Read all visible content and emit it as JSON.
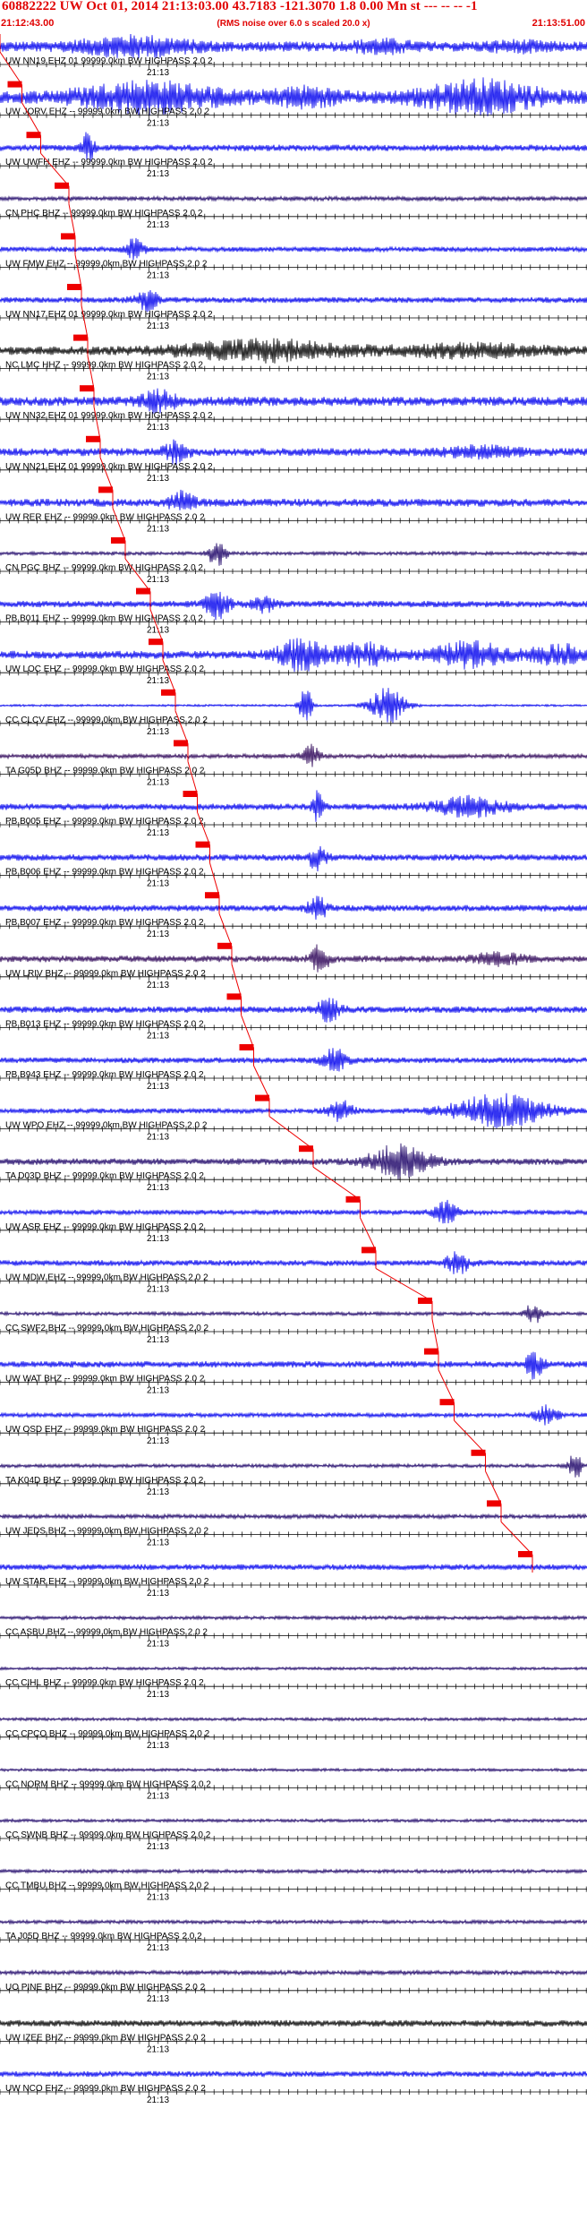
{
  "header": {
    "title": "60882222 UW Oct 01, 2014 21:13:03.00   43.7183 -121.3070  1.8 0.00 Mn st --- -- --  -1",
    "start_time": "21:12:43.00",
    "rms_note": "(RMS noise over 6.0 s scaled 20.0 x)",
    "end_time": "21:13:51.00"
  },
  "colors": {
    "title": "#e00000",
    "pick": "#ee0000",
    "trace_blue": "#0000ee",
    "trace_navy": "#1a0066",
    "trace_black": "#000000",
    "trace_purple": "#2a0055",
    "axis": "#000000"
  },
  "chart_data": {
    "type": "seismogram",
    "title": "60882222 UW Oct 01, 2014 21:13:03.00   43.7183 -121.3070  1.8 0.00 Mn st --- -- --  -1",
    "time_axis": {
      "start": "21:12:43.00",
      "end": "21:13:51.00",
      "minute_label": "21:13"
    },
    "series": [
      {
        "label": "UW NN19 EHZ 01 99999.0km BW  HIGHPASS  2.0  2",
        "pick": 1.0,
        "color": "blue",
        "amp": 0.7,
        "events": [
          {
            "c": 0.23,
            "w": 0.09,
            "a": 1.1
          },
          {
            "c": 0.65,
            "w": 0.05,
            "a": 0.6
          },
          {
            "c": 0.88,
            "w": 0.05,
            "a": 0.4
          }
        ]
      },
      {
        "label": "UW JORV EHZ -- 99999.0km BW  HIGHPASS  2.0  2",
        "pick": 1.007,
        "color": "blue",
        "amp": 0.8,
        "events": [
          {
            "c": 0.25,
            "w": 0.12,
            "a": 1.8
          },
          {
            "c": 0.52,
            "w": 0.06,
            "a": 1.0
          },
          {
            "c": 0.82,
            "w": 0.1,
            "a": 2.0
          }
        ]
      },
      {
        "label": "UW UWFH EHZ -- 99999.0km BW  HIGHPASS  2.0  2",
        "pick": 1.013,
        "color": "blue",
        "amp": 0.45,
        "events": [
          {
            "c": 0.15,
            "w": 0.01,
            "a": 2.0
          }
        ]
      },
      {
        "label": "CN PHC BHZ -- 99999.0km BW  HIGHPASS  2.0  2",
        "pick": 1.022,
        "color": "navy",
        "amp": 0.3,
        "events": []
      },
      {
        "label": "UW FMW EHZ -- 99999.0km BW  HIGHPASS  2.0  2",
        "pick": 1.024,
        "color": "blue",
        "amp": 0.35,
        "events": [
          {
            "c": 0.23,
            "w": 0.015,
            "a": 1.4
          }
        ]
      },
      {
        "label": "UW NN17 EHZ 01 99999.0km BW  HIGHPASS  2.0  2",
        "pick": 1.026,
        "color": "blue",
        "amp": 0.4,
        "events": [
          {
            "c": 0.25,
            "w": 0.02,
            "a": 1.3
          }
        ]
      },
      {
        "label": "NC LMC HHZ -- 99999.0km BW  HIGHPASS  2.0  2",
        "pick": 1.028,
        "color": "black",
        "amp": 0.6,
        "events": [
          {
            "c": 0.45,
            "w": 0.14,
            "a": 1.2
          },
          {
            "c": 0.8,
            "w": 0.12,
            "a": 0.7
          }
        ]
      },
      {
        "label": "UW NN32 EHZ 01 99999.0km BW  HIGHPASS  2.0  2",
        "pick": 1.03,
        "color": "blue",
        "amp": 0.65,
        "events": [
          {
            "c": 0.27,
            "w": 0.03,
            "a": 1.2
          }
        ]
      },
      {
        "label": "UW NN21 EHZ 01 99999.0km BW  HIGHPASS  2.0  2",
        "pick": 1.032,
        "color": "blue",
        "amp": 0.55,
        "events": [
          {
            "c": 0.3,
            "w": 0.02,
            "a": 1.3
          },
          {
            "c": 0.82,
            "w": 0.06,
            "a": 0.6
          }
        ]
      },
      {
        "label": "UW RER EHZ -- 99999.0km BW  HIGHPASS  2.0  2",
        "pick": 1.036,
        "color": "blue",
        "amp": 0.55,
        "events": [
          {
            "c": 0.31,
            "w": 0.02,
            "a": 1.3
          }
        ]
      },
      {
        "label": "CN PGC BHZ -- 99999.0km BW  HIGHPASS  2.0  2",
        "pick": 1.04,
        "color": "navy",
        "amp": 0.25,
        "events": [
          {
            "c": 0.37,
            "w": 0.015,
            "a": 1.8
          }
        ]
      },
      {
        "label": "PB B011 EHZ -- 99999.0km BW  HIGHPASS  2.0  2",
        "pick": 1.048,
        "color": "blue",
        "amp": 0.45,
        "events": [
          {
            "c": 0.37,
            "w": 0.02,
            "a": 1.8
          },
          {
            "c": 0.45,
            "w": 0.02,
            "a": 1.0
          }
        ]
      },
      {
        "label": "UW LOC EHZ -- 99999.0km BW  HIGHPASS  2.0  2",
        "pick": 1.052,
        "color": "blue",
        "amp": 0.55,
        "events": [
          {
            "c": 0.51,
            "w": 0.04,
            "a": 2.0
          },
          {
            "c": 0.62,
            "w": 0.05,
            "a": 1.4
          },
          {
            "c": 0.8,
            "w": 0.06,
            "a": 1.6
          },
          {
            "c": 0.95,
            "w": 0.05,
            "a": 1.2
          }
        ]
      },
      {
        "label": "CC CLCV EHZ -- 99999.0km BW  HIGHPASS  2.0  2",
        "pick": 1.056,
        "color": "blue",
        "amp": 0.15,
        "events": [
          {
            "c": 0.52,
            "w": 0.01,
            "a": 3.0
          },
          {
            "c": 0.66,
            "w": 0.03,
            "a": 2.5
          }
        ]
      },
      {
        "label": "TA G05D BHZ -- 99999.0km BW  HIGHPASS  2.0  2",
        "pick": 1.06,
        "color": "purple",
        "amp": 0.3,
        "events": [
          {
            "c": 0.53,
            "w": 0.015,
            "a": 1.4
          }
        ]
      },
      {
        "label": "PB B005 EHZ -- 99999.0km BW  HIGHPASS  2.0  2",
        "pick": 1.063,
        "color": "blue",
        "amp": 0.45,
        "events": [
          {
            "c": 0.54,
            "w": 0.01,
            "a": 2.0
          },
          {
            "c": 0.8,
            "w": 0.06,
            "a": 1.2
          }
        ]
      },
      {
        "label": "PB B006 EHZ -- 99999.0km BW  HIGHPASS  2.0  2",
        "pick": 1.067,
        "color": "blue",
        "amp": 0.45,
        "events": [
          {
            "c": 0.54,
            "w": 0.015,
            "a": 1.5
          }
        ]
      },
      {
        "label": "PB B007 EHZ -- 99999.0km BW  HIGHPASS  2.0  2",
        "pick": 1.07,
        "color": "blue",
        "amp": 0.45,
        "events": [
          {
            "c": 0.54,
            "w": 0.015,
            "a": 1.8
          }
        ]
      },
      {
        "label": "UW LRIV BHZ -- 99999.0km BW  HIGHPASS  2.0  2",
        "pick": 1.074,
        "color": "purple",
        "amp": 0.45,
        "events": [
          {
            "c": 0.545,
            "w": 0.015,
            "a": 1.8
          },
          {
            "c": 0.85,
            "w": 0.04,
            "a": 0.8
          }
        ]
      },
      {
        "label": "PB B013 EHZ -- 99999.0km BW  HIGHPASS  2.0  2",
        "pick": 1.077,
        "color": "blue",
        "amp": 0.45,
        "events": [
          {
            "c": 0.56,
            "w": 0.02,
            "a": 1.6
          }
        ]
      },
      {
        "label": "PB B943 EHZ -- 99999.0km BW  HIGHPASS  2.0  2",
        "pick": 1.081,
        "color": "blue",
        "amp": 0.4,
        "events": [
          {
            "c": 0.57,
            "w": 0.02,
            "a": 1.6
          }
        ]
      },
      {
        "label": "UW WPO EHZ -- 99999.0km BW  HIGHPASS  2.0  2",
        "pick": 1.086,
        "color": "blue",
        "amp": 0.35,
        "events": [
          {
            "c": 0.58,
            "w": 0.02,
            "a": 1.4
          },
          {
            "c": 0.85,
            "w": 0.08,
            "a": 2.2
          }
        ]
      },
      {
        "label": "TA D03D BHZ -- 99999.0km BW  HIGHPASS  2.0  2",
        "pick": 1.1,
        "color": "navy",
        "amp": 0.45,
        "events": [
          {
            "c": 0.68,
            "w": 0.05,
            "a": 2.2
          }
        ]
      },
      {
        "label": "UW ASR EHZ -- 99999.0km BW  HIGHPASS  2.0  2",
        "pick": 1.115,
        "color": "blue",
        "amp": 0.35,
        "events": [
          {
            "c": 0.76,
            "w": 0.02,
            "a": 1.4
          }
        ]
      },
      {
        "label": "UW MDW EHZ -- 99999.0km BW  HIGHPASS  2.0  2",
        "pick": 1.12,
        "color": "blue",
        "amp": 0.4,
        "events": [
          {
            "c": 0.78,
            "w": 0.02,
            "a": 1.4
          }
        ]
      },
      {
        "label": "CC SWF2 BHZ -- 99999.0km BW  HIGHPASS  2.0  2",
        "pick": 1.138,
        "color": "navy",
        "amp": 0.25,
        "events": [
          {
            "c": 0.91,
            "w": 0.015,
            "a": 1.6
          }
        ]
      },
      {
        "label": "UW WAT BHZ -- 99999.0km BW  HIGHPASS  2.0  2",
        "pick": 1.14,
        "color": "blue",
        "amp": 0.45,
        "events": [
          {
            "c": 0.91,
            "w": 0.015,
            "a": 1.8
          }
        ]
      },
      {
        "label": "UW OSD EHZ -- 99999.0km BW  HIGHPASS  2.0  2",
        "pick": 1.145,
        "color": "blue",
        "amp": 0.3,
        "events": [
          {
            "c": 0.93,
            "w": 0.02,
            "a": 1.2
          }
        ]
      },
      {
        "label": "TA K04D BHZ -- 99999.0km BW  HIGHPASS  2.0  2",
        "pick": 1.155,
        "color": "navy",
        "amp": 0.25,
        "events": [
          {
            "c": 0.98,
            "w": 0.01,
            "a": 2.0
          }
        ]
      },
      {
        "label": "UW JEDS BHZ -- 99999.0km BW  HIGHPASS  2.0  2",
        "pick": 1.16,
        "color": "navy",
        "amp": 0.3,
        "events": []
      },
      {
        "label": "UW STAR EHZ -- 99999.0km BW  HIGHPASS  2.0  2",
        "pick": 1.17,
        "color": "blue",
        "amp": 0.4,
        "events": []
      },
      {
        "label": "CC ASBU BHZ -- 99999.0km BW  HIGHPASS  2.0  2",
        "pick": null,
        "color": "navy",
        "amp": 0.25,
        "events": []
      },
      {
        "label": "CC CIHL BHZ -- 99999.0km BW  HIGHPASS  2.0  2",
        "pick": null,
        "color": "navy",
        "amp": 0.2,
        "events": []
      },
      {
        "label": "CC CPCO BHZ -- 99999.0km BW  HIGHPASS  2.0  2",
        "pick": null,
        "color": "navy",
        "amp": 0.22,
        "events": []
      },
      {
        "label": "CC NORM BHZ -- 99999.0km BW  HIGHPASS  2.0  2",
        "pick": null,
        "color": "navy",
        "amp": 0.2,
        "events": []
      },
      {
        "label": "CC SWNB BHZ -- 99999.0km BW  HIGHPASS  2.0  2",
        "pick": null,
        "color": "navy",
        "amp": 0.22,
        "events": []
      },
      {
        "label": "CC TMBU BHZ -- 99999.0km BW  HIGHPASS  2.0  2",
        "pick": null,
        "color": "navy",
        "amp": 0.25,
        "events": []
      },
      {
        "label": "TA J05D BHZ -- 99999.0km BW  HIGHPASS  2.0  2",
        "pick": null,
        "color": "navy",
        "amp": 0.25,
        "events": []
      },
      {
        "label": "UO PINE BHZ -- 99999.0km BW  HIGHPASS  2.0  2",
        "pick": null,
        "color": "navy",
        "amp": 0.3,
        "events": []
      },
      {
        "label": "UW IZEE BHZ -- 99999.0km BW  HIGHPASS  2.0  2",
        "pick": null,
        "color": "black",
        "amp": 0.45,
        "events": []
      },
      {
        "label": "UW NCO EHZ -- 99999.0km BW  HIGHPASS  2.0  2",
        "pick": null,
        "color": "blue",
        "amp": 0.4,
        "events": []
      }
    ]
  }
}
